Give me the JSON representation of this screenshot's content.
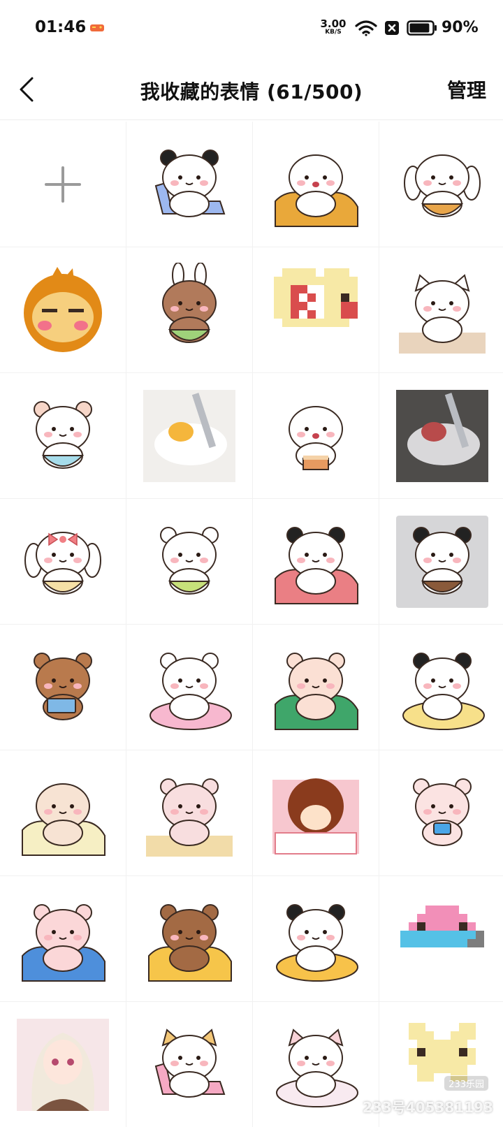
{
  "status_bar": {
    "time": "01:46",
    "net_speed_value": "3.00",
    "net_speed_unit": "KB/S",
    "battery_level": 0.9,
    "battery_text": "90%",
    "icons": [
      "game-icon",
      "wifi-icon",
      "close-box-icon",
      "battery-icon"
    ]
  },
  "header": {
    "back_icon": "chevron-left-icon",
    "title": "我收藏的表情 (61/500)",
    "manage_label": "管理"
  },
  "grid": {
    "add_icon": "plus-icon",
    "stickers": [
      "panda-reading-chair-sticker",
      "blanket-noodles-sticker",
      "bunny-bread-basket-sticker",
      "monkey-face-sticker",
      "bear-bunny-hood-sticker",
      "pixel-popcorn-sticker",
      "cat-bowl-sticker",
      "white-cat-bowl-sticker",
      "fried-egg-photo-sticker",
      "bear-cake-sticker",
      "cooking-photo-sticker",
      "bow-bunny-plate-sticker",
      "cat-salad-bowl-sticker",
      "panda-phone-bed-sticker",
      "panda-noodles-sticker",
      "brown-bear-reading-sticker",
      "white-bear-pillow-sticker",
      "bear-blanket-sticker",
      "panda-phone-cushion-sticker",
      "girl-bed-phone-sticker",
      "bear-big-eyes-sticker",
      "afro-girl-bed-sticker",
      "bear-phone-lying-sticker",
      "pink-bear-blanket-sticker",
      "bear-tablet-bed-sticker",
      "panda-bear-sleep-sticker",
      "pixel-pink-cat-sticker",
      "anime-girl-sticker",
      "cat-pink-chair-sticker",
      "white-cat-lying-sticker",
      "pixel-yellow-bunny-sticker"
    ]
  },
  "watermark": {
    "badge": "233乐园",
    "text": "233号405381193"
  }
}
